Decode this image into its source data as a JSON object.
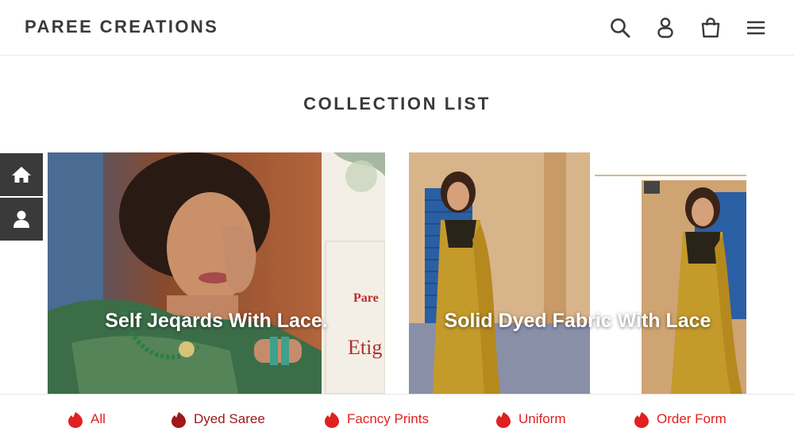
{
  "header": {
    "brand": "PAREE CREATIONS",
    "icons": [
      "search-icon",
      "account-icon",
      "cart-icon",
      "menu-icon"
    ]
  },
  "main": {
    "title": "COLLECTION LIST",
    "collections": [
      {
        "title": "Self Jeqards With Lace."
      },
      {
        "title": "Solid Dyed Fabric With Lace"
      }
    ]
  },
  "side_buttons": [
    "home-icon",
    "user-icon"
  ],
  "bottom_nav": {
    "items": [
      {
        "label": "All",
        "color": "#e02020"
      },
      {
        "label": "Dyed Saree",
        "color": "#a01818"
      },
      {
        "label": "Facncy Prints",
        "color": "#e02020"
      },
      {
        "label": "Uniform",
        "color": "#e02020"
      },
      {
        "label": "Order Form",
        "color": "#e02020"
      }
    ]
  },
  "colors": {
    "text": "#3a3a3a",
    "accent": "#e02020",
    "side_button_bg": "#3a3a3a"
  }
}
